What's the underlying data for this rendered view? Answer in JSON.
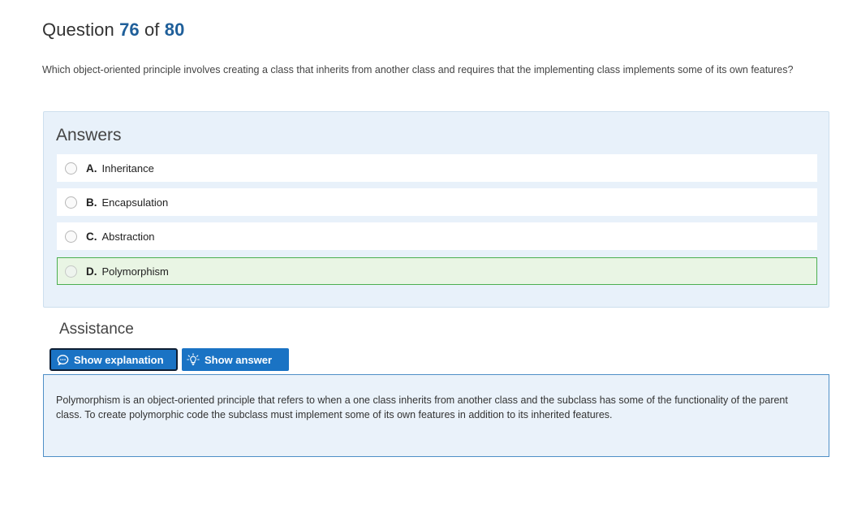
{
  "question": {
    "prefix": "Question",
    "current": "76",
    "of_label": "of",
    "total": "80",
    "text": "Which object-oriented principle involves creating a class that inherits from another class and requires that the implementing class implements some of its own features?"
  },
  "answers": {
    "title": "Answers",
    "options": [
      {
        "letter": "A.",
        "text": "Inheritance",
        "correct": false
      },
      {
        "letter": "B.",
        "text": "Encapsulation",
        "correct": false
      },
      {
        "letter": "C.",
        "text": "Abstraction",
        "correct": false
      },
      {
        "letter": "D.",
        "text": "Polymorphism",
        "correct": true
      }
    ]
  },
  "assistance": {
    "title": "Assistance",
    "show_explanation_label": "Show explanation",
    "show_answer_label": "Show answer",
    "explanation": "Polymorphism is an object-oriented principle that refers to when a one class inherits from another class and the subclass has some of the functionality of the parent class. To create polymorphic code the subclass must implement some of its own features in addition to its inherited features."
  },
  "colors": {
    "accent": "#1a73c4",
    "question_number": "#1f5f9a",
    "correct_border": "#4caf50",
    "correct_background": "#e9f5e4",
    "panel_background": "#e8f1fa"
  },
  "icons": {
    "show_explanation": "chat-bubble-icon",
    "show_answer": "lightbulb-icon"
  }
}
